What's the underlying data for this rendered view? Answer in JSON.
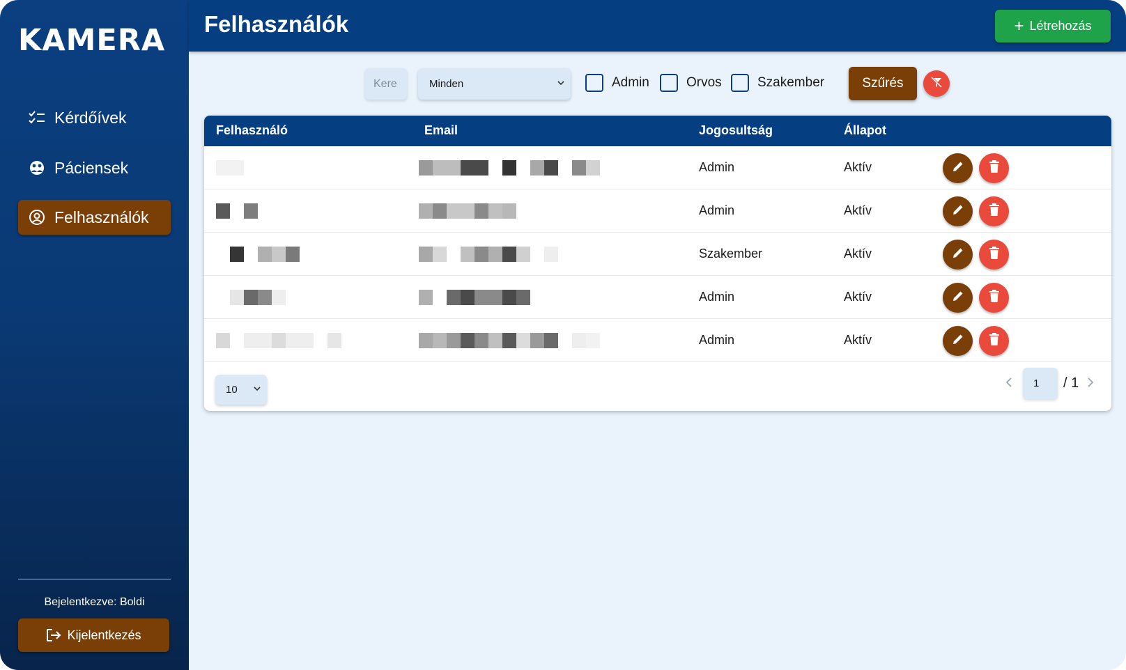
{
  "app": {
    "logo": "KAMERA"
  },
  "sidebar": {
    "items": [
      {
        "label": "Kérdőívek",
        "icon": "checklist-icon",
        "active": false
      },
      {
        "label": "Páciensek",
        "icon": "patients-icon",
        "active": false
      },
      {
        "label": "Felhasználók",
        "icon": "user-circle-icon",
        "active": true
      }
    ],
    "logged_in_text": "Bejelentkezve: Boldi",
    "logout_label": "Kijelentkezés"
  },
  "header": {
    "title": "Felhasználók",
    "create_label": "Létrehozás"
  },
  "filters": {
    "search_placeholder": "Kere",
    "role_select_value": "Minden",
    "checkboxes": [
      {
        "label": "Admin",
        "checked": false
      },
      {
        "label": "Orvos",
        "checked": false
      },
      {
        "label": "Szakember",
        "checked": false
      }
    ],
    "filter_label": "Szűrés"
  },
  "table": {
    "columns": [
      "Felhasználó",
      "Email",
      "Jogosultság",
      "Állapot"
    ],
    "rows": [
      {
        "role": "Admin",
        "status": "Aktív"
      },
      {
        "role": "Admin",
        "status": "Aktív"
      },
      {
        "role": "Szakember",
        "status": "Aktív"
      },
      {
        "role": "Admin",
        "status": "Aktív"
      },
      {
        "role": "Admin",
        "status": "Aktív"
      }
    ]
  },
  "pagination": {
    "page_size": "10",
    "current_page": "1",
    "total_pages": "/ 1"
  },
  "colors": {
    "primary_blue": "#053f82",
    "accent_brown": "#7a3e07",
    "create_green": "#1fa34a",
    "delete_red": "#ea4a3c",
    "content_bg": "#eaf3fc"
  }
}
